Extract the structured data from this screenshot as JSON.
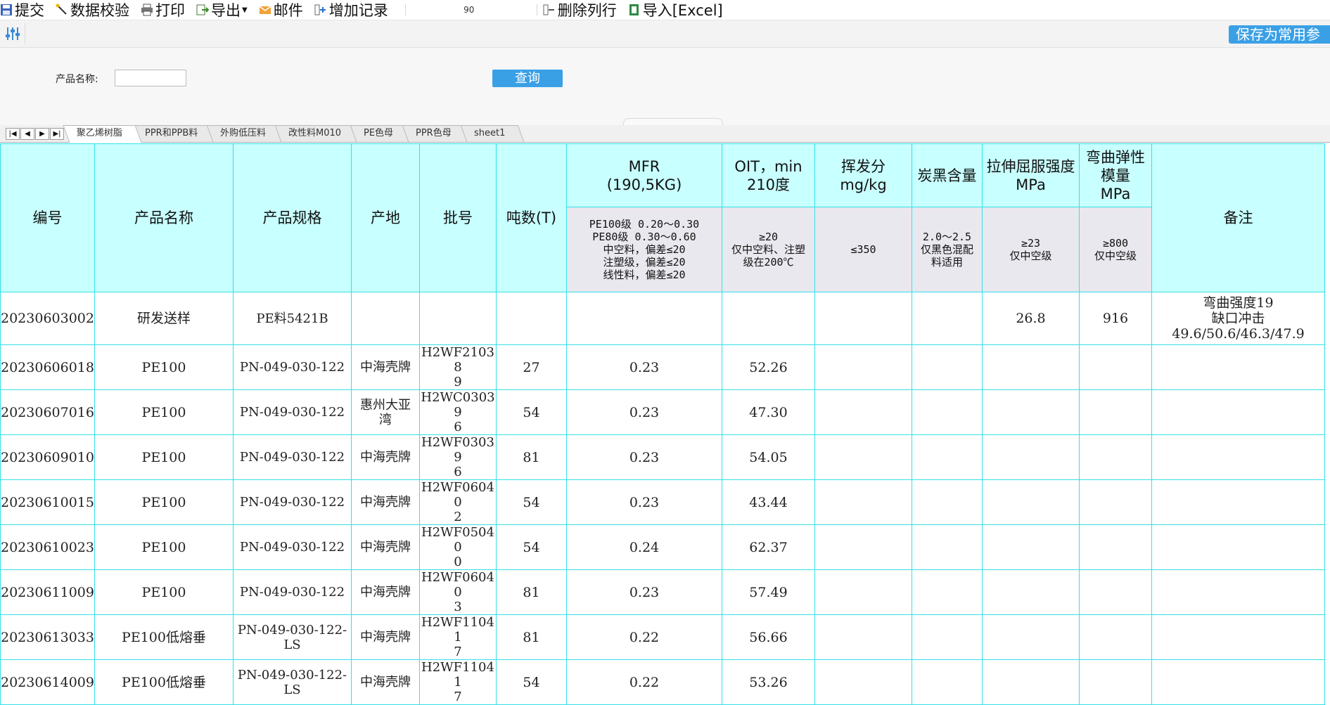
{
  "toolbar": {
    "submit": "提交",
    "validate": "数据校验",
    "print": "打印",
    "export": "导出",
    "mail": "邮件",
    "add_record": "增加记录",
    "row_count": "90",
    "delete_rows": "删除列行",
    "import_excel": "导入[Excel]"
  },
  "action_bar": {
    "save_common": "保存为常用参"
  },
  "filter": {
    "product_name_label": "产品名称:",
    "product_name_value": "",
    "query_button": "查询"
  },
  "sheet_tabs": [
    "聚乙烯树脂",
    "PPR和PPB料",
    "外购低压料",
    "改性料M010",
    "PE色母",
    "PPR色母",
    "sheet1"
  ],
  "table": {
    "headers": {
      "id": "编号",
      "product_name": "产品名称",
      "spec": "产品规格",
      "origin": "产地",
      "batch": "批号",
      "tons": "吨数(T)",
      "mfr": "MFR\n(190,5KG)",
      "oit": "OIT，min\n210度",
      "volatile": "挥发分\nmg/kg",
      "carbon": "炭黑含量",
      "tensile": "拉伸屈服强度\nMPa",
      "flex": "弯曲弹性\n模量\nMPa",
      "remark": "备注"
    },
    "sub_headers": {
      "mfr": "PE100级 0.20～0.30\nPE80级 0.30～0.60\n中空料，偏差≤20\n注塑级，偏差≤20\n线性料，偏差≤20",
      "oit": "≥20\n仅中空料、注塑\n级在200℃",
      "volatile": "≤350",
      "carbon": "2.0～2.5\n仅黑色混配\n料适用",
      "tensile": "≥23\n仅中空级",
      "flex": "≥800\n仅中空级"
    },
    "rows": [
      {
        "id": "20230603002",
        "product_name": "研发送样",
        "spec": "PE料5421B",
        "origin": "",
        "batch": "",
        "tons": "",
        "mfr": "",
        "oit": "",
        "volatile": "",
        "carbon": "",
        "tensile": "26.8",
        "flex": "916",
        "remark": "弯曲强度19\n缺口冲击\n49.6/50.6/46.3/47.9"
      },
      {
        "id": "20230606018",
        "product_name": "PE100",
        "spec": "PN-049-030-122",
        "origin": "中海壳牌",
        "batch": "H2WF21038\n9",
        "tons": "27",
        "mfr": "0.23",
        "oit": "52.26",
        "volatile": "",
        "carbon": "",
        "tensile": "",
        "flex": "",
        "remark": ""
      },
      {
        "id": "20230607016",
        "product_name": "PE100",
        "spec": "PN-049-030-122",
        "origin": "惠州大亚\n湾",
        "batch": "H2WC03039\n6",
        "tons": "54",
        "mfr": "0.23",
        "oit": "47.30",
        "volatile": "",
        "carbon": "",
        "tensile": "",
        "flex": "",
        "remark": ""
      },
      {
        "id": "20230609010",
        "product_name": "PE100",
        "spec": "PN-049-030-122",
        "origin": "中海壳牌",
        "batch": "H2WF03039\n6",
        "tons": "81",
        "mfr": "0.23",
        "oit": "54.05",
        "volatile": "",
        "carbon": "",
        "tensile": "",
        "flex": "",
        "remark": ""
      },
      {
        "id": "20230610015",
        "product_name": "PE100",
        "spec": "PN-049-030-122",
        "origin": "中海壳牌",
        "batch": "H2WF06040\n2",
        "tons": "54",
        "mfr": "0.23",
        "oit": "43.44",
        "volatile": "",
        "carbon": "",
        "tensile": "",
        "flex": "",
        "remark": ""
      },
      {
        "id": "20230610023",
        "product_name": "PE100",
        "spec": "PN-049-030-122",
        "origin": "中海壳牌",
        "batch": "H2WF05040\n0",
        "tons": "54",
        "mfr": "0.24",
        "oit": "62.37",
        "volatile": "",
        "carbon": "",
        "tensile": "",
        "flex": "",
        "remark": ""
      },
      {
        "id": "20230611009",
        "product_name": "PE100",
        "spec": "PN-049-030-122",
        "origin": "中海壳牌",
        "batch": "H2WF06040\n3",
        "tons": "81",
        "mfr": "0.23",
        "oit": "57.49",
        "volatile": "",
        "carbon": "",
        "tensile": "",
        "flex": "",
        "remark": ""
      },
      {
        "id": "20230613033",
        "product_name": "PE100低熔垂",
        "spec": "PN-049-030-122-\nLS",
        "origin": "中海壳牌",
        "batch": "H2WF11041\n7",
        "tons": "81",
        "mfr": "0.22",
        "oit": "56.66",
        "volatile": "",
        "carbon": "",
        "tensile": "",
        "flex": "",
        "remark": ""
      },
      {
        "id": "20230614009",
        "product_name": "PE100低熔垂",
        "spec": "PN-049-030-122-\nLS",
        "origin": "中海壳牌",
        "batch": "H2WF11041\n7",
        "tons": "54",
        "mfr": "0.22",
        "oit": "53.26",
        "volatile": "",
        "carbon": "",
        "tensile": "",
        "flex": "",
        "remark": ""
      }
    ]
  },
  "colors": {
    "header_bg": "#c8ffff",
    "subheader_bg": "#e8e8ee",
    "grid_line": "#33e0e8",
    "button_blue": "#3aa0e6"
  }
}
